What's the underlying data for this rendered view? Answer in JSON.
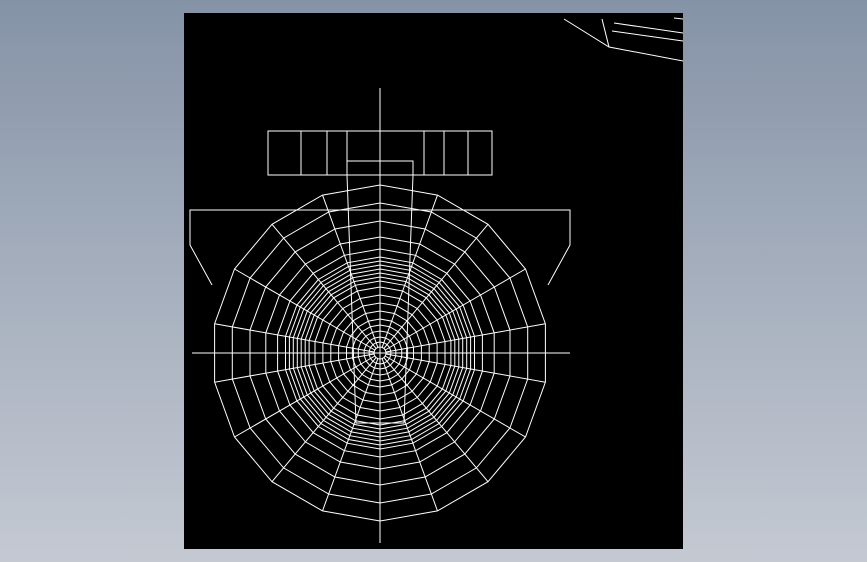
{
  "viewport": {
    "background": "#000000",
    "line_color": "#ffffff"
  },
  "drawing": {
    "kind": "cad-wireframe",
    "view": "front",
    "part": {
      "shape": "polygonal-wheel-mesh",
      "polygon_sides": 18,
      "ring_count": 22,
      "hub": "small-center-polygon",
      "top_bar": "rectangular-block-with-dividers",
      "flange": "trapezoid-flange"
    }
  }
}
